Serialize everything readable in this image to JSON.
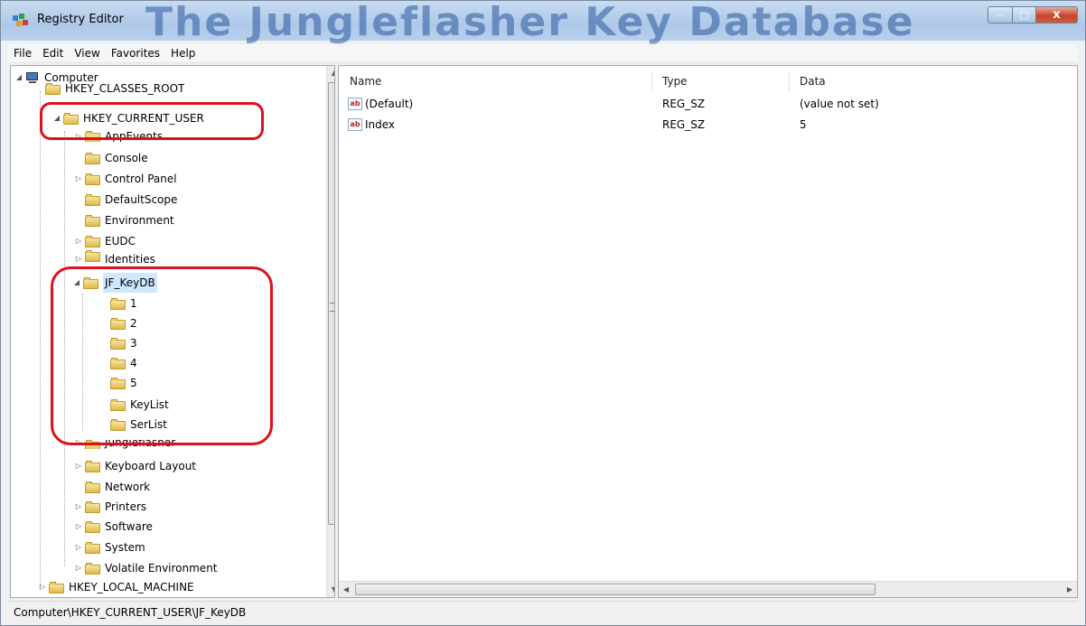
{
  "window": {
    "title": "Registry Editor",
    "watermark": "The Jungleflasher Key Database",
    "controls": {
      "minimize": "–",
      "maximize": "□",
      "close": "x"
    }
  },
  "menu": [
    "File",
    "Edit",
    "View",
    "Favorites",
    "Help"
  ],
  "tree": {
    "root": "Computer",
    "hives": {
      "classes_root": "HKEY_CLASSES_ROOT",
      "current_user": "HKEY_CURRENT_USER",
      "local_machine": "HKEY_LOCAL_MACHINE"
    },
    "current_user_children": [
      "AppEvents",
      "Console",
      "Control Panel",
      "DefaultScope",
      "Environment",
      "EUDC",
      "Identities",
      "JF_KeyDB"
    ],
    "jf_keydb_children": [
      "1",
      "2",
      "3",
      "4",
      "5",
      "KeyList",
      "SerList"
    ],
    "current_user_children_after": [
      "Jungleflasher",
      "Keyboard Layout",
      "Network",
      "Printers",
      "Software",
      "System",
      "Volatile Environment"
    ],
    "selected": "JF_KeyDB"
  },
  "list": {
    "columns": {
      "name": "Name",
      "type": "Type",
      "data": "Data"
    },
    "rows": [
      {
        "icon": "ab",
        "name": "(Default)",
        "type": "REG_SZ",
        "data": "(value not set)"
      },
      {
        "icon": "ab",
        "name": "Index",
        "type": "REG_SZ",
        "data": "5"
      }
    ]
  },
  "status": {
    "path": "Computer\\HKEY_CURRENT_USER\\JF_KeyDB"
  },
  "colors": {
    "highlight": "#e0101a",
    "selection": "#cde8ff"
  }
}
